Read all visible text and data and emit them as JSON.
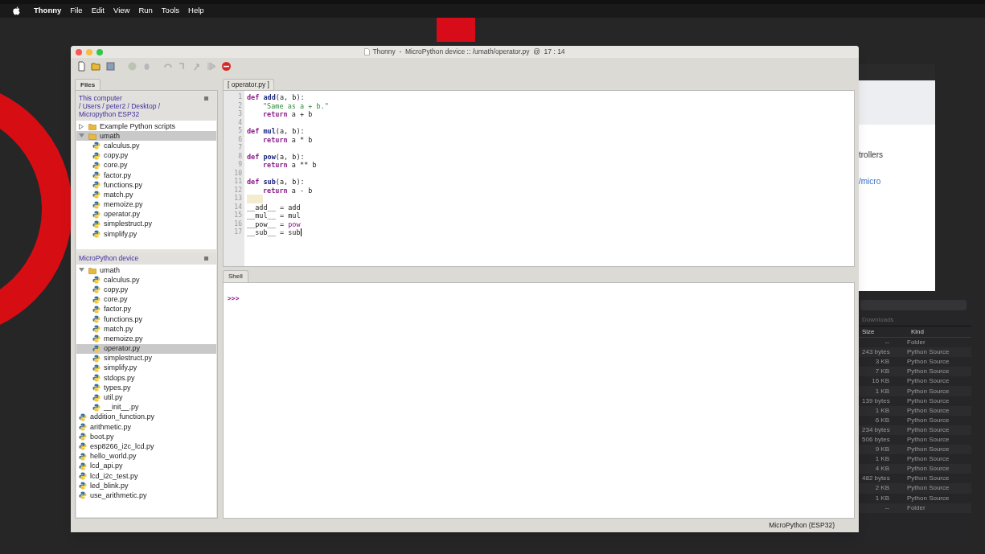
{
  "menubar": {
    "app": "Thonny",
    "items": [
      "File",
      "Edit",
      "View",
      "Run",
      "Tools",
      "Help"
    ]
  },
  "browser": {
    "texts": [
      "trollers",
      "/micro"
    ]
  },
  "finder": {
    "tab": "Downloads",
    "columns": [
      "Size",
      "Kind"
    ],
    "rows": [
      {
        "size": "--",
        "kind": "Folder"
      },
      {
        "size": "243 bytes",
        "kind": "Python Source"
      },
      {
        "size": "3 KB",
        "kind": "Python Source"
      },
      {
        "size": "7 KB",
        "kind": "Python Source"
      },
      {
        "size": "16 KB",
        "kind": "Python Source"
      },
      {
        "size": "1 KB",
        "kind": "Python Source"
      },
      {
        "size": "139 bytes",
        "kind": "Python Source"
      },
      {
        "size": "1 KB",
        "kind": "Python Source"
      },
      {
        "size": "6 KB",
        "kind": "Python Source"
      },
      {
        "size": "234 bytes",
        "kind": "Python Source"
      },
      {
        "size": "506 bytes",
        "kind": "Python Source"
      },
      {
        "size": "9 KB",
        "kind": "Python Source"
      },
      {
        "size": "1 KB",
        "kind": "Python Source"
      },
      {
        "size": "4 KB",
        "kind": "Python Source"
      },
      {
        "size": "482 bytes",
        "kind": "Python Source"
      },
      {
        "size": "2 KB",
        "kind": "Python Source"
      },
      {
        "size": "1 KB",
        "kind": "Python Source"
      },
      {
        "size": "--",
        "kind": "Folder"
      }
    ]
  },
  "window": {
    "title": "Thonny  -  MicroPython device :: /umath/operator.py  @  17 : 14"
  },
  "files_tab": {
    "label": "Files",
    "selected": true
  },
  "computer_panel": {
    "path_lines": [
      "This computer",
      "/ Users / peter2 / Desktop /",
      "Micropython ESP32"
    ],
    "tree": [
      {
        "name": "Example Python scripts",
        "kind": "folder",
        "expanded": false,
        "selected": false
      },
      {
        "name": "umath",
        "kind": "folder",
        "expanded": true,
        "selected": true,
        "children": [
          {
            "name": "calculus.py",
            "kind": "file",
            "selected": false
          },
          {
            "name": "copy.py",
            "kind": "file",
            "selected": false
          },
          {
            "name": "core.py",
            "kind": "file",
            "selected": false
          },
          {
            "name": "factor.py",
            "kind": "file",
            "selected": false
          },
          {
            "name": "functions.py",
            "kind": "file",
            "selected": false
          },
          {
            "name": "match.py",
            "kind": "file",
            "selected": false
          },
          {
            "name": "memoize.py",
            "kind": "file",
            "selected": false
          },
          {
            "name": "operator.py",
            "kind": "file",
            "selected": false
          },
          {
            "name": "simplestruct.py",
            "kind": "file",
            "selected": false
          },
          {
            "name": "simplify.py",
            "kind": "file",
            "selected": false
          }
        ]
      }
    ]
  },
  "device_panel": {
    "title": "MicroPython device",
    "tree": [
      {
        "name": "umath",
        "kind": "folder",
        "expanded": true,
        "selected": false,
        "children": [
          {
            "name": "calculus.py",
            "kind": "file",
            "selected": false
          },
          {
            "name": "copy.py",
            "kind": "file",
            "selected": false
          },
          {
            "name": "core.py",
            "kind": "file",
            "selected": false
          },
          {
            "name": "factor.py",
            "kind": "file",
            "selected": false
          },
          {
            "name": "functions.py",
            "kind": "file",
            "selected": false
          },
          {
            "name": "match.py",
            "kind": "file",
            "selected": false
          },
          {
            "name": "memoize.py",
            "kind": "file",
            "selected": false
          },
          {
            "name": "operator.py",
            "kind": "file",
            "selected": true
          },
          {
            "name": "simplestruct.py",
            "kind": "file",
            "selected": false
          },
          {
            "name": "simplify.py",
            "kind": "file",
            "selected": false
          },
          {
            "name": "stdops.py",
            "kind": "file",
            "selected": false
          },
          {
            "name": "types.py",
            "kind": "file",
            "selected": false
          },
          {
            "name": "util.py",
            "kind": "file",
            "selected": false
          },
          {
            "name": "__init__.py",
            "kind": "file",
            "selected": false
          }
        ]
      },
      {
        "name": "addition_function.py",
        "kind": "file",
        "selected": false
      },
      {
        "name": "arithmetic.py",
        "kind": "file",
        "selected": false
      },
      {
        "name": "boot.py",
        "kind": "file",
        "selected": false
      },
      {
        "name": "esp8266_i2c_lcd.py",
        "kind": "file",
        "selected": false
      },
      {
        "name": "hello_world.py",
        "kind": "file",
        "selected": false
      },
      {
        "name": "lcd_api.py",
        "kind": "file",
        "selected": false
      },
      {
        "name": "lcd_i2c_test.py",
        "kind": "file",
        "selected": false
      },
      {
        "name": "led_blink.py",
        "kind": "file",
        "selected": false
      },
      {
        "name": "use_arithmetic.py",
        "kind": "file",
        "selected": false
      }
    ]
  },
  "editor": {
    "tab": {
      "label": "[ operator.py ]",
      "selected": true
    },
    "lines": [
      {
        "number": "1",
        "highlight": false,
        "tokens": [
          {
            "text": "def ",
            "kind": "keyword"
          },
          {
            "text": "add",
            "kind": "name"
          },
          {
            "text": "(a, b):",
            "kind": "plain"
          }
        ]
      },
      {
        "number": "2",
        "highlight": false,
        "indented": true,
        "tokens": [
          {
            "text": "\"Same as a + b.\"",
            "kind": "string"
          }
        ]
      },
      {
        "number": "3",
        "highlight": false,
        "indented": true,
        "tokens": [
          {
            "text": "return",
            "kind": "keyword"
          },
          {
            "text": " a + b",
            "kind": "plain"
          }
        ]
      },
      {
        "number": "4",
        "highlight": false
      },
      {
        "number": "5",
        "highlight": false,
        "tokens": [
          {
            "text": "def ",
            "kind": "keyword"
          },
          {
            "text": "mul",
            "kind": "name"
          },
          {
            "text": "(a, b):",
            "kind": "plain"
          }
        ]
      },
      {
        "number": "6",
        "highlight": false,
        "indented": true,
        "tokens": [
          {
            "text": "return",
            "kind": "keyword"
          },
          {
            "text": " a * b",
            "kind": "plain"
          }
        ]
      },
      {
        "number": "7",
        "highlight": false
      },
      {
        "number": "8",
        "highlight": false,
        "tokens": [
          {
            "text": "def ",
            "kind": "keyword"
          },
          {
            "text": "pow",
            "kind": "name"
          },
          {
            "text": "(a, b):",
            "kind": "plain"
          }
        ]
      },
      {
        "number": "9",
        "highlight": false,
        "indented": true,
        "tokens": [
          {
            "text": "return",
            "kind": "keyword"
          },
          {
            "text": " a ** b",
            "kind": "plain"
          }
        ]
      },
      {
        "number": "10",
        "highlight": false
      },
      {
        "number": "11",
        "highlight": false,
        "tokens": [
          {
            "text": "def ",
            "kind": "keyword"
          },
          {
            "text": "sub",
            "kind": "name"
          },
          {
            "text": "(a, b):",
            "kind": "plain"
          }
        ]
      },
      {
        "number": "12",
        "highlight": false,
        "indented": true,
        "tokens": [
          {
            "text": "return",
            "kind": "keyword"
          },
          {
            "text": " a - b",
            "kind": "plain"
          }
        ]
      },
      {
        "number": "13",
        "highlight": true
      },
      {
        "number": "14",
        "highlight": false,
        "tokens": [
          {
            "text": "__add__ = add",
            "kind": "plain"
          }
        ]
      },
      {
        "number": "15",
        "highlight": false,
        "tokens": [
          {
            "text": "__mul__ = mul",
            "kind": "plain"
          }
        ]
      },
      {
        "number": "16",
        "highlight": false,
        "tokens": [
          {
            "text": "__pow__ = ",
            "kind": "plain"
          },
          {
            "text": "pow",
            "kind": "builtin"
          }
        ]
      },
      {
        "number": "17",
        "highlight": false,
        "tokens": [
          {
            "text": "__sub__ = sub",
            "kind": "plain"
          }
        ]
      }
    ]
  },
  "shell": {
    "tab": {
      "label": "Shell",
      "selected": true
    },
    "prompt": ">>>"
  },
  "status_bar": {
    "text": "MicroPython (ESP32)"
  }
}
